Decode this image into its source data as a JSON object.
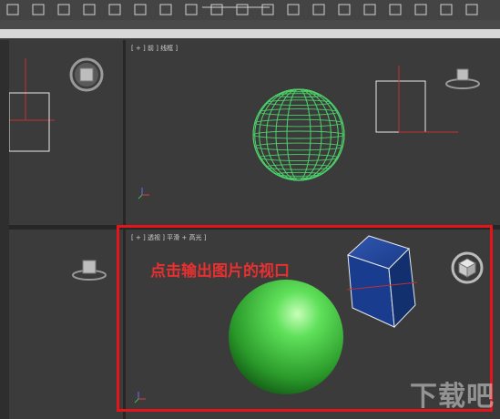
{
  "toolbar": {
    "icons": [
      "select-icon",
      "move-icon",
      "rotate-icon",
      "scale-icon",
      "link-icon",
      "unlink-icon",
      "bind-icon",
      "snap-icon",
      "angle-snap-icon",
      "percent-snap-icon",
      "mirror-icon",
      "align-icon",
      "layer-icon",
      "curve-editor-icon",
      "schematic-icon",
      "material-editor-icon",
      "render-setup-icon",
      "render-frame-icon",
      "render-icon"
    ]
  },
  "viewports": {
    "front": {
      "label": "[ + ] 前 ] 线框 ]"
    },
    "perspective": {
      "label": "[ + ] 透视 ] 平滑 + 高光 ]"
    }
  },
  "annotation": {
    "text": "点击输出图片的视口"
  },
  "watermark": {
    "text": "下载吧"
  },
  "colors": {
    "highlight": "#e3141a",
    "wire_sphere": "#4cd06a",
    "solid_sphere": "#45c845",
    "cube": "#163a8c"
  }
}
